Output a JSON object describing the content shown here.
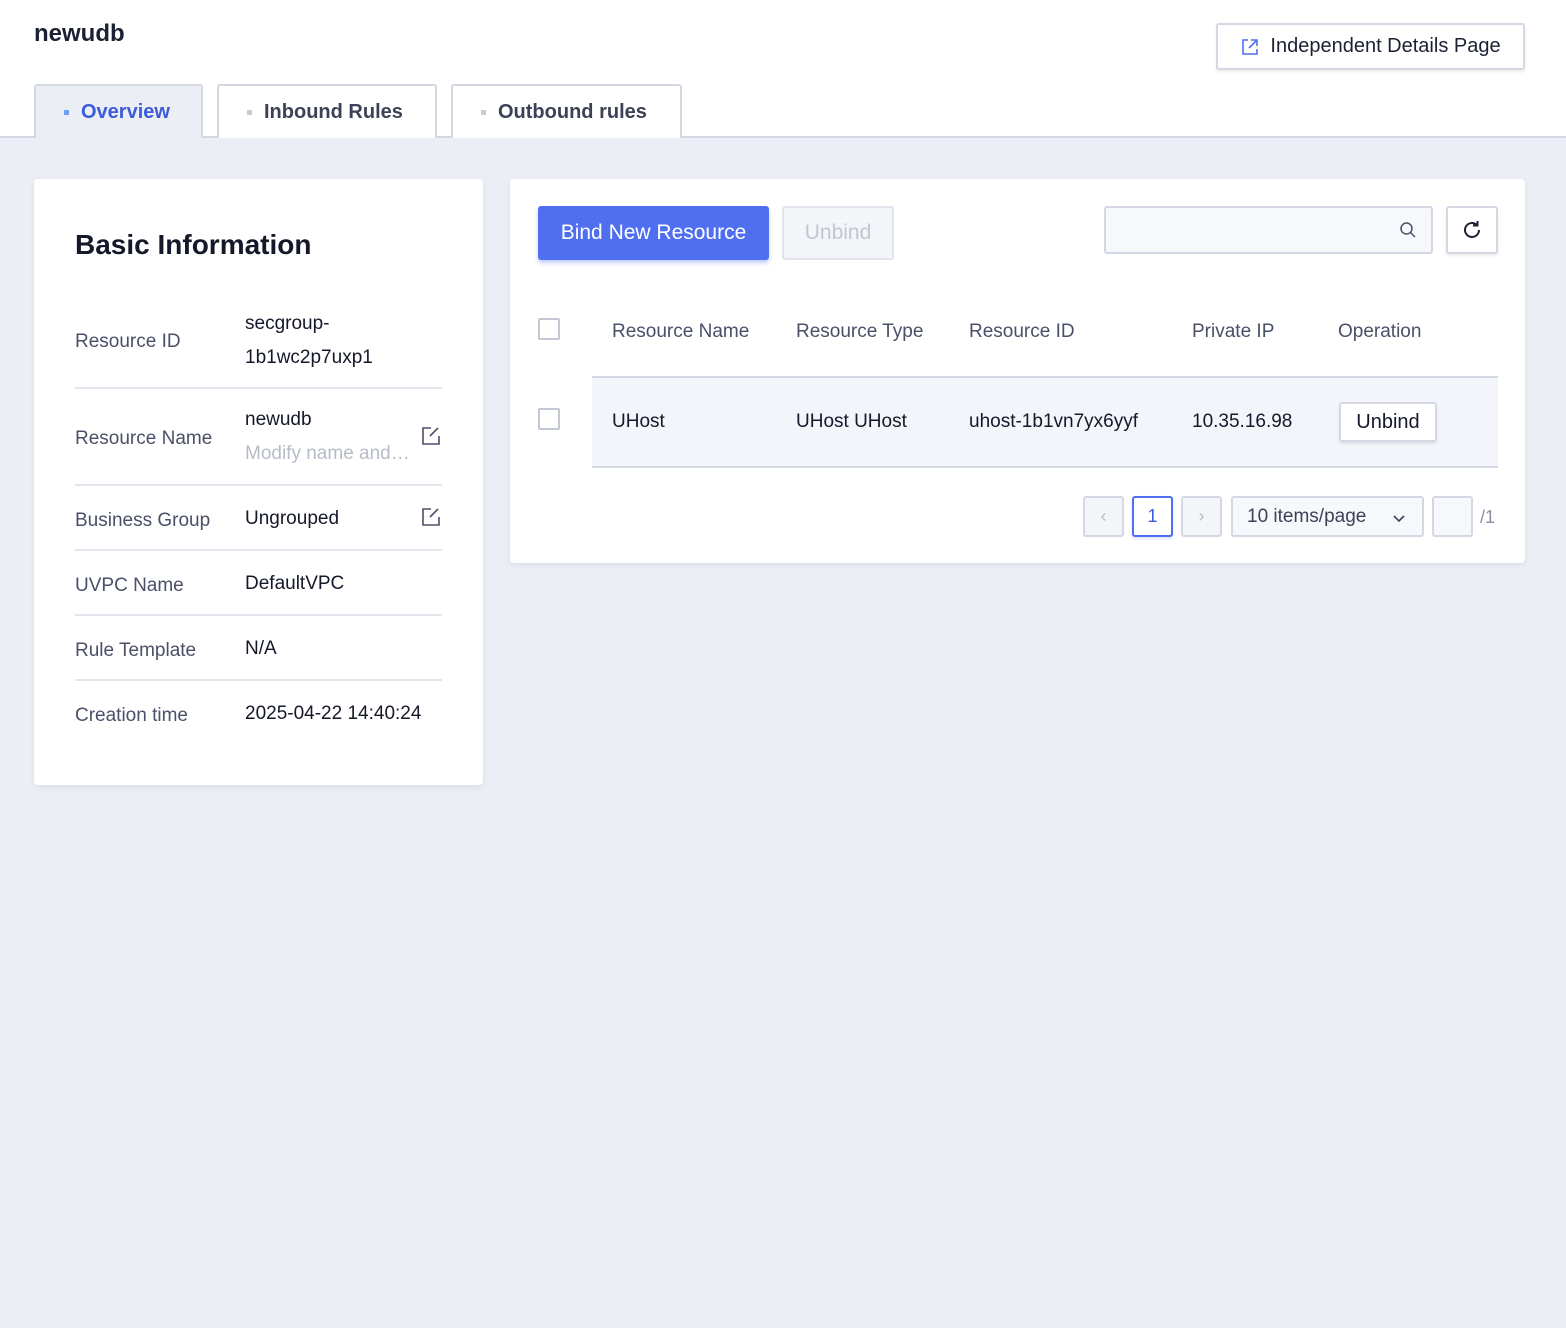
{
  "header": {
    "title": "newudb",
    "details_button": "Independent Details Page"
  },
  "tabs": [
    {
      "label": "Overview",
      "active": true
    },
    {
      "label": "Inbound Rules",
      "active": false
    },
    {
      "label": "Outbound rules",
      "active": false
    }
  ],
  "basic_info": {
    "title": "Basic Information",
    "rows": [
      {
        "label": "Resource ID",
        "value_line1": "secgroup-",
        "value_line2": "1b1wc2p7uxp1"
      },
      {
        "label": "Resource Name",
        "value": "newudb",
        "placeholder": "Modify name and remark"
      },
      {
        "label": "Business Group",
        "value": "Ungrouped"
      },
      {
        "label": "UVPC Name",
        "value": "DefaultVPC"
      },
      {
        "label": "Rule Template",
        "value": "N/A"
      },
      {
        "label": "Creation time",
        "value": "2025-04-22 14:40:24"
      }
    ]
  },
  "resources": {
    "bind_button": "Bind New Resource",
    "unbind_button": "Unbind",
    "search_placeholder": "",
    "columns": [
      "Resource Name",
      "Resource Type",
      "Resource ID",
      "Private IP",
      "Operation"
    ],
    "rows": [
      {
        "name": "UHost",
        "type": "UHost UHost",
        "id": "uhost-1b1vn7yx6yyf",
        "ip": "10.35.16.98",
        "action": "Unbind"
      }
    ],
    "pagination": {
      "prev": "‹",
      "next": "›",
      "current_page": "1",
      "page_size": "10 items/page",
      "total": "/1"
    }
  },
  "colors": {
    "primary": "#4f6ff0",
    "background": "#eceef5",
    "active_tab_text": "#3b5bdb"
  }
}
